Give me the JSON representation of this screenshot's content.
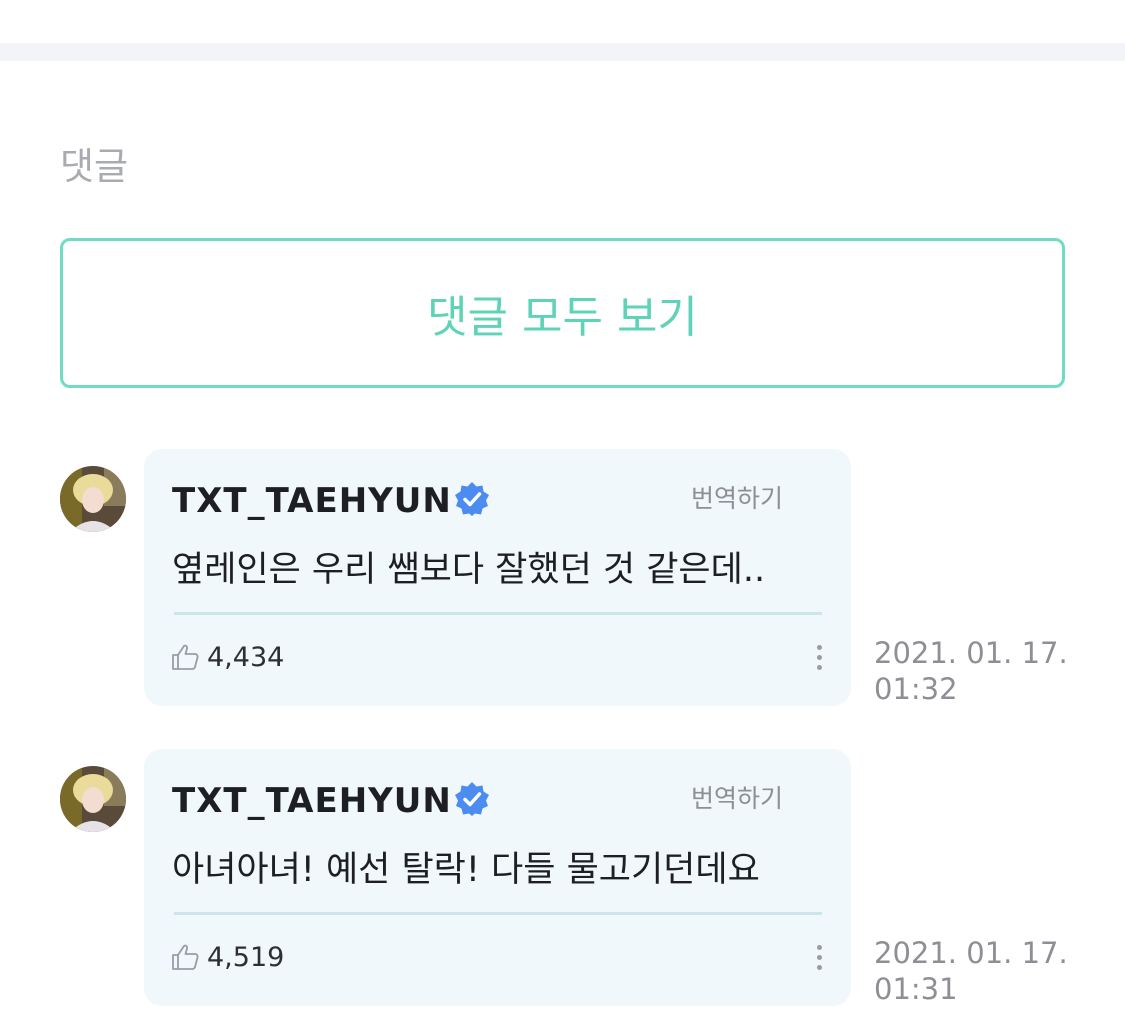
{
  "section": {
    "title": "댓글"
  },
  "view_all": {
    "label": "댓글 모두 보기"
  },
  "colors": {
    "accent": "#5fd3b8",
    "verified": "#4c8cf0",
    "bubble": "#f0f8fc"
  },
  "comments": [
    {
      "author": "TXT_TAEHYUN",
      "verified_icon": "verified-badge-icon",
      "translate_label": "번역하기",
      "text": "옆레인은 우리 쌤보다 잘했던 것 같은데..",
      "likes": "4,434",
      "date": "2021. 01. 17.",
      "time": "01:32"
    },
    {
      "author": "TXT_TAEHYUN",
      "verified_icon": "verified-badge-icon",
      "translate_label": "번역하기",
      "text": "아녀아녀! 예선 탈락! 다들 물고기던데요",
      "likes": "4,519",
      "date": "2021. 01. 17.",
      "time": "01:31"
    }
  ]
}
